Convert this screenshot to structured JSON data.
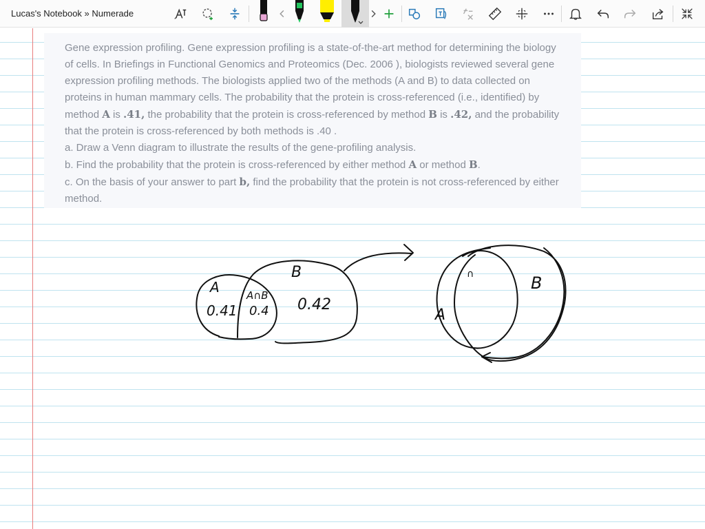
{
  "app": {
    "title": "Lucas's Notebook » Numerade"
  },
  "toolbar": {
    "buttons": [
      {
        "name": "text-to-ink-button",
        "icon": "text-ai-icon"
      },
      {
        "name": "lasso-select-button",
        "icon": "lasso-select-icon"
      },
      {
        "name": "add-space-button",
        "icon": "add-space-icon"
      },
      {
        "name": "eraser-button",
        "icon": "eraser-icon"
      },
      {
        "name": "scroll-left-button",
        "icon": "chevron-left-icon"
      },
      {
        "name": "pen-green-button",
        "icon": "pen-icon"
      },
      {
        "name": "highlighter-yellow-button",
        "icon": "highlighter-icon"
      },
      {
        "name": "pen-black-button",
        "icon": "pen-icon"
      },
      {
        "name": "scroll-right-button",
        "icon": "chevron-right-icon"
      },
      {
        "name": "add-pen-button",
        "icon": "plus-icon"
      },
      {
        "name": "ink-to-shape-button",
        "icon": "ink-to-shape-icon"
      },
      {
        "name": "ink-to-text-button",
        "icon": "ink-to-text-icon"
      },
      {
        "name": "math-button",
        "icon": "math-icon"
      },
      {
        "name": "ruler-button",
        "icon": "ruler-icon"
      },
      {
        "name": "grid-button",
        "icon": "grid-icon"
      },
      {
        "name": "more-button",
        "icon": "ellipsis-icon"
      },
      {
        "name": "notifications-button",
        "icon": "bell-icon"
      },
      {
        "name": "undo-button",
        "icon": "undo-icon"
      },
      {
        "name": "redo-button",
        "icon": "redo-icon"
      },
      {
        "name": "share-button",
        "icon": "share-icon"
      },
      {
        "name": "collapse-button",
        "icon": "collapse-icon"
      }
    ],
    "colors": {
      "eraser_pink": "#e9a7d6",
      "pen_green": "#22c55e",
      "highlighter_yellow": "#ffee00",
      "pen_black": "#111111",
      "accent_green": "#1e9e3a",
      "accent_blue": "#2a7ab8"
    }
  },
  "question": {
    "p1": "Gene expression profiling. Gene expression profiling is a state-of-the-art method for determining the biology of cells. In Briefings in Functional Genomics and Proteomics (Dec. 2006 ), biologists reviewed several gene expression profiling methods. The biologists applied two of the methods (A and B) to data collected on proteins in human mammary cells. The probability that the protein is cross-referenced (i.e., identified) by method ",
    "m1": "A",
    "p2": " is ",
    "m2": ".41,",
    "p3": " the probability that the protein is cross-referenced by method ",
    "m3": "B",
    "p4": " is ",
    "m4": ".42,",
    "p5": " and the probability that the protein is cross-referenced by both methods is .40 .",
    "a": "a. Draw a Venn diagram to illustrate the results of the gene-profiling analysis.",
    "b1": "b. Find the probability that the protein is cross-referenced by either method ",
    "bA": "A",
    "b2": " or method ",
    "bB": "B",
    "b3": ".",
    "c1": "c. On the basis of your answer to part ",
    "cb": "b,",
    "c2": " find the probability that the protein is not cross-referenced by either method."
  },
  "handwriting": {
    "label_a": "A",
    "label_b": "B",
    "label_a_and_b": "A∩B",
    "value_a": "0.41",
    "value_a_and_b": "0.4",
    "value_b": "0.42",
    "label_a2": "A",
    "label_b2": "B",
    "label_intersection2": "∩"
  },
  "colors": {
    "page_background": "#ffffff",
    "rule_line": "#bfe3ef",
    "margin_line": "#e87c7c",
    "card_background": "#f7f8fb",
    "question_text": "#8a8f99",
    "ink": "#111111"
  }
}
